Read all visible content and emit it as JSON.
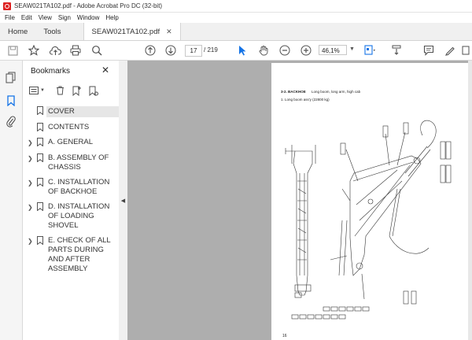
{
  "window": {
    "title": "SEAW021TA102.pdf - Adobe Acrobat Pro DC (32-bit)"
  },
  "menu": [
    "File",
    "Edit",
    "View",
    "Sign",
    "Window",
    "Help"
  ],
  "tabs": {
    "home": "Home",
    "tools": "Tools",
    "document": "SEAW021TA102.pdf"
  },
  "toolbar": {
    "current_page": "17",
    "total_pages": "/ 219",
    "zoom": "46,1%"
  },
  "bookmarks": {
    "title": "Bookmarks",
    "items": [
      {
        "label": "COVER",
        "expandable": false,
        "selected": true
      },
      {
        "label": "CONTENTS",
        "expandable": false,
        "selected": false
      },
      {
        "label": "A. GENERAL",
        "expandable": true,
        "selected": false
      },
      {
        "label": "B. ASSEMBLY OF CHASSIS",
        "expandable": true,
        "selected": false
      },
      {
        "label": "C. INSTALLATION OF BACKHOE",
        "expandable": true,
        "selected": false
      },
      {
        "label": "D. INSTALLATION OF LOADING SHOVEL",
        "expandable": true,
        "selected": false
      },
      {
        "label": "E. CHECK OF ALL PARTS DURING AND AFTER ASSEMBLY",
        "expandable": true,
        "selected": false
      }
    ]
  },
  "document": {
    "section": "3-2.  BACKHOE",
    "subtitle": "Long boom, long arm, high cab",
    "item": "1.    Long boom ass'y (22800 kg)",
    "page_number": "16"
  },
  "colors": {
    "accent": "#1473e6",
    "tool_gray": "#505050"
  }
}
